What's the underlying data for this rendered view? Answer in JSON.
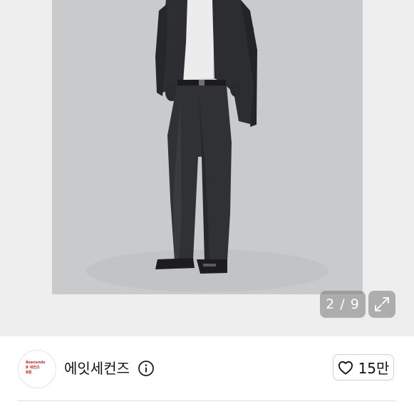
{
  "gallery": {
    "counter": "2 / 9",
    "expand_icon": "expand-icon",
    "photo_icon": "product-photo"
  },
  "seller": {
    "avatar_lines": [
      "8seconds",
      "8 세컨즈",
      "8원"
    ],
    "avatar_color": "#c8262b",
    "name": "에잇세컨즈",
    "info_icon": "info-icon"
  },
  "like": {
    "icon": "heart-icon",
    "count": "15만"
  }
}
